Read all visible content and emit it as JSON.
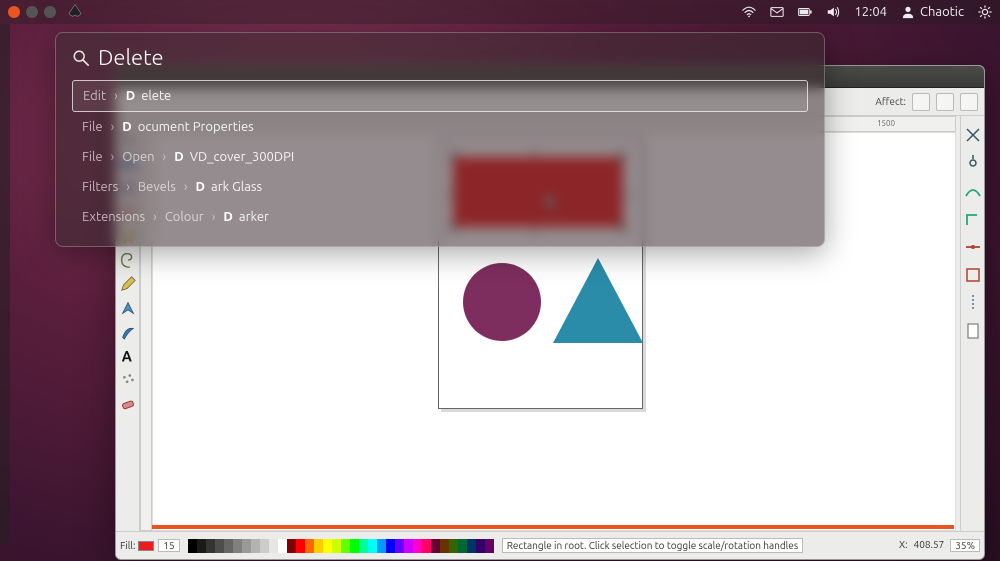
{
  "panel": {
    "time": "12:04",
    "user": "Chaotic"
  },
  "hud": {
    "query": "Delete",
    "typed_prefix": "D",
    "results": [
      {
        "crumbs": [
          "Edit"
        ],
        "hl": "D",
        "rest": "elete",
        "active": true
      },
      {
        "crumbs": [
          "File"
        ],
        "hl": "D",
        "rest": "ocument Properties",
        "active": false
      },
      {
        "crumbs": [
          "File",
          "Open"
        ],
        "hl": "D",
        "rest": "VD_cover_300DPI",
        "active": false
      },
      {
        "crumbs": [
          "Filters",
          "Bevels"
        ],
        "hl": "D",
        "rest": "ark Glass",
        "active": false
      },
      {
        "crumbs": [
          "Extensions",
          "Colour"
        ],
        "hl": "D",
        "rest": "arker",
        "active": false
      }
    ]
  },
  "inkscape": {
    "toolbar_right_label": "Affect:",
    "ruler_tick": "1500",
    "status": {
      "fill_label": "Fill:",
      "fill_hex": "#ee1c1c",
      "layer_num": "15",
      "message": "Rectangle in root. Click selection to toggle scale/rotation handles",
      "x_label": "X:",
      "x_value": "408.57",
      "zoom": "35%"
    },
    "shapes": {
      "rectangle_color": "#ee1c1c",
      "circle_color": "#7d2e5e",
      "triangle_color": "#2a8ca8"
    },
    "palette_colors": [
      "#000000",
      "#1a1a1a",
      "#333333",
      "#4d4d4d",
      "#666666",
      "#808080",
      "#999999",
      "#b3b3b3",
      "#cccccc",
      "#e6e6e6",
      "#ffffff",
      "#800000",
      "#ff0000",
      "#ff6600",
      "#ffcc00",
      "#ffff00",
      "#ccff00",
      "#66ff00",
      "#00ff00",
      "#00ff99",
      "#00ffff",
      "#0099ff",
      "#0000ff",
      "#6600ff",
      "#cc00ff",
      "#ff00cc",
      "#ff0066",
      "#660033",
      "#663300",
      "#336600",
      "#006633",
      "#003366",
      "#330066",
      "#660066"
    ]
  }
}
